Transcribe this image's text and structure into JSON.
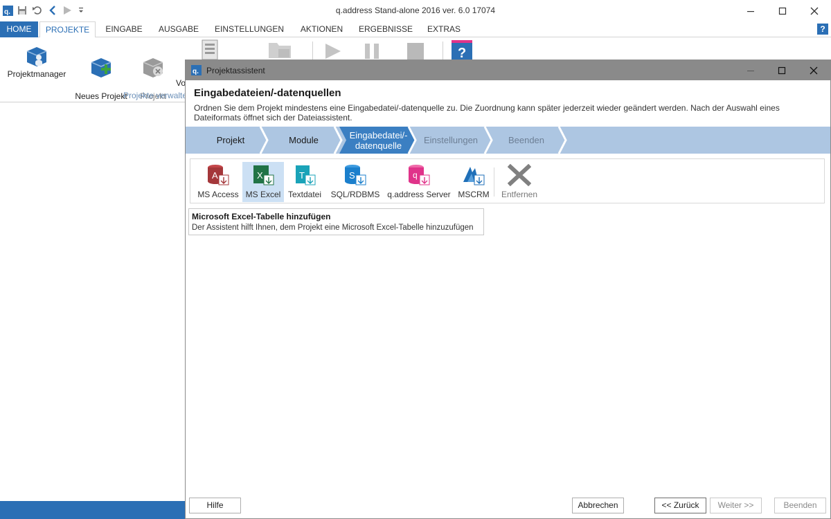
{
  "app": {
    "title": "q.address Stand-alone 2016 ver. 6.0 17074",
    "logo_letter": "q."
  },
  "ribbon_tabs": [
    "HOME",
    "PROJEKTE",
    "EINGABE",
    "AUSGABE",
    "EINSTELLUNGEN",
    "AKTIONEN",
    "ERGEBNISSE",
    "EXTRAS"
  ],
  "ribbon": {
    "buttons": [
      {
        "label": "Projektmanager",
        "icon": "project-manager-icon"
      },
      {
        "label": "Neues Projekt\nerstellen",
        "icon": "new-project-icon"
      },
      {
        "label": "Projekt\nschließen",
        "icon": "close-project-icon"
      },
      {
        "label": "Vo",
        "icon": "settings-doc-icon"
      }
    ],
    "group_label": "Projekte verwalte"
  },
  "dialog": {
    "title": "Projektassistent",
    "heading": "Eingabedateien/-datenquellen",
    "description": "Ordnen Sie dem Projekt mindestens eine Eingabedatei/-datenquelle zu. Die Zuordnung kann später jederzeit wieder geändert werden. Nach der Auswahl eines Dateiformats öffnet sich der Dateiassistent.",
    "steps": [
      {
        "label": "Projekt",
        "state": "done"
      },
      {
        "label": "Module",
        "state": "done"
      },
      {
        "label": "Eingabedatei/-\ndatenquelle",
        "state": "current"
      },
      {
        "label": "Einstellungen",
        "state": "pending"
      },
      {
        "label": "Beenden",
        "state": "pending"
      }
    ],
    "sources": [
      {
        "label": "MS Access",
        "icon": "ms-access-icon",
        "color": "#a4373a"
      },
      {
        "label": "MS Excel",
        "icon": "ms-excel-icon",
        "color": "#217346",
        "selected": true
      },
      {
        "label": "Textdatei",
        "icon": "text-file-icon",
        "color": "#1aa3b8"
      },
      {
        "label": "SQL/RDBMS",
        "icon": "sql-database-icon",
        "color": "#1b7fcc"
      },
      {
        "label": "q.address Server",
        "icon": "qaddress-server-icon",
        "color": "#e0338a"
      },
      {
        "label": "MSCRM",
        "icon": "mscrm-icon",
        "color": "#1f6fb8"
      },
      {
        "label": "Entfernen",
        "icon": "remove-x-icon",
        "color": "#808080"
      }
    ],
    "info": {
      "heading": "Microsoft Excel-Tabelle hinzufügen",
      "text": "Der Assistent hilft Ihnen, dem Projekt eine Microsoft Excel-Tabelle hinzuzufügen"
    },
    "buttons": {
      "help": "Hilfe",
      "cancel": "Abbrechen",
      "back": "<< Zurück",
      "next": "Weiter >>",
      "finish": "Beenden"
    }
  },
  "colors": {
    "accent": "#2b6fb5",
    "steps_done": "#adc6e2",
    "steps_current": "#3b7fc2"
  }
}
